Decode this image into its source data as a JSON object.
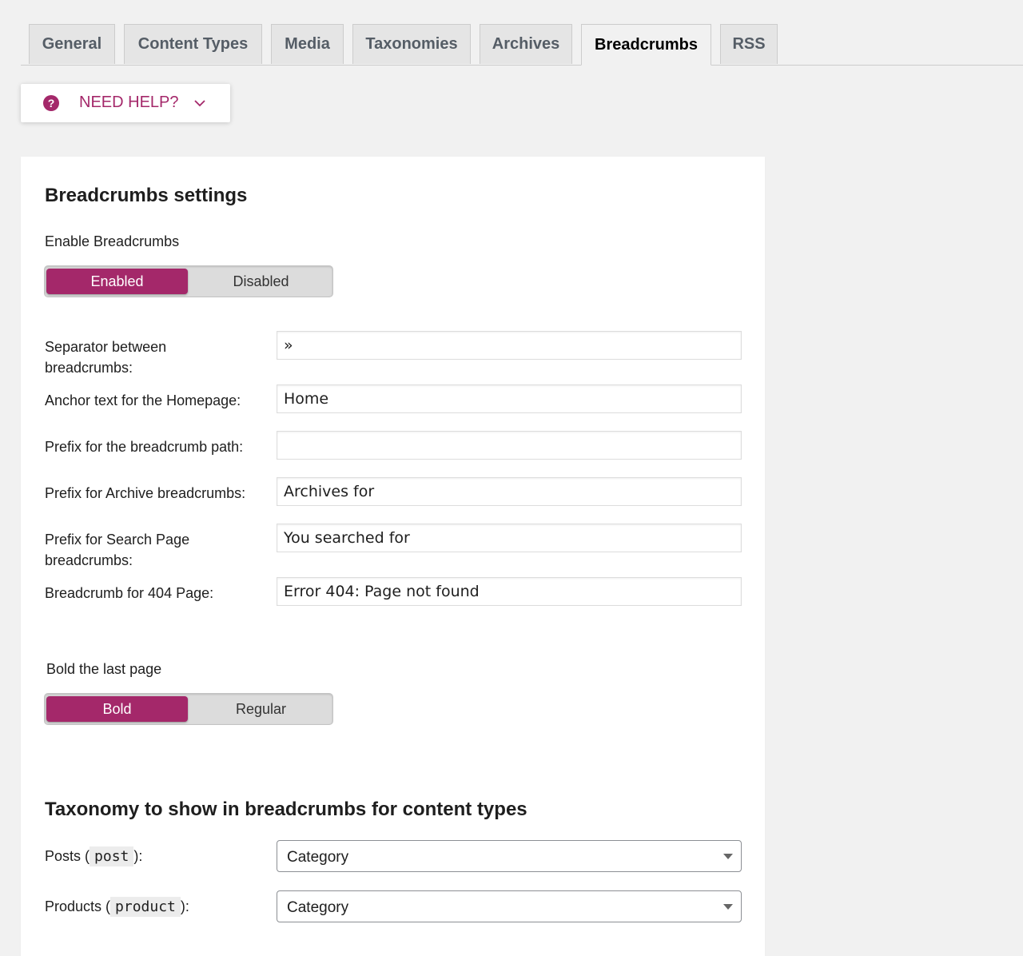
{
  "tabs": [
    {
      "label": "General"
    },
    {
      "label": "Content Types"
    },
    {
      "label": "Media"
    },
    {
      "label": "Taxonomies"
    },
    {
      "label": "Archives"
    },
    {
      "label": "Breadcrumbs",
      "active": true
    },
    {
      "label": "RSS"
    }
  ],
  "help": {
    "label": "NEED HELP?",
    "icon": "question-circle-icon",
    "chevron": "chevron-down-icon"
  },
  "accent_color": "#a4286a",
  "settings": {
    "title": "Breadcrumbs settings",
    "enable": {
      "label": "Enable Breadcrumbs",
      "options": [
        "Enabled",
        "Disabled"
      ],
      "selected": "Enabled"
    },
    "fields": [
      {
        "label": "Separator between breadcrumbs:",
        "value": "»"
      },
      {
        "label": "Anchor text for the Homepage:",
        "value": "Home"
      },
      {
        "label": "Prefix for the breadcrumb path:",
        "value": ""
      },
      {
        "label": "Prefix for Archive breadcrumbs:",
        "value": "Archives for"
      },
      {
        "label": "Prefix for Search Page breadcrumbs:",
        "value": "You searched for"
      },
      {
        "label": "Breadcrumb for 404 Page:",
        "value": "Error 404: Page not found"
      }
    ],
    "bold_last": {
      "label": "Bold the last page",
      "options": [
        "Bold",
        "Regular"
      ],
      "selected": "Bold"
    }
  },
  "taxonomy": {
    "title": "Taxonomy to show in breadcrumbs for content types",
    "rows": [
      {
        "label_pre": "Posts (",
        "code": "post",
        "label_post": "):",
        "value": "Category"
      },
      {
        "label_pre": "Products (",
        "code": "product",
        "label_post": "):",
        "value": "Category"
      }
    ]
  }
}
